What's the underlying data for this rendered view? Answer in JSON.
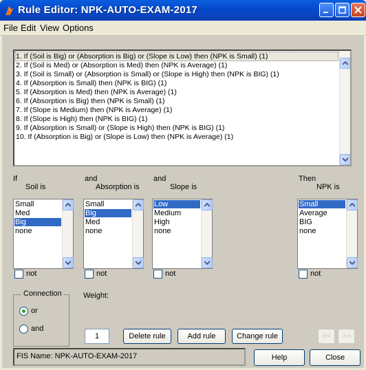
{
  "window": {
    "title": "Rule Editor: NPK-AUTO-EXAM-2017"
  },
  "menu": {
    "items": [
      "File",
      "Edit",
      "View",
      "Options"
    ]
  },
  "rules": [
    "1. If (Soil is Big) or (Absorption is Big) or (Slope is Low) then (NPK is Small) (1)",
    "2. If (Soil is Med) or (Absorption is Med) then (NPK is Average) (1)",
    "3. If (Soil is Small) or (Absorption is Small) or (Slope is High) then (NPK is BIG) (1)",
    "4. If (Absorption is Small) then (NPK is BIG) (1)",
    "5. If (Absorption is Med) then (NPK is Average) (1)",
    "6. If (Absorption is Big) then (NPK is Small) (1)",
    "7. If (Slope is Medium) then (NPK is Average) (1)",
    "8. If (Slope is High) then (NPK is BIG) (1)",
    "9. If (Absorption is Small) or (Slope is High) then (NPK is BIG) (1)",
    "10. If (Absorption is Big) or (Slope is Low) then (NPK is Average) (1)"
  ],
  "selected_rule": 0,
  "inputs": [
    {
      "prefix": "If",
      "name": "Soil is",
      "options": [
        "Small",
        "Med",
        "Big",
        "none"
      ],
      "selected": 2,
      "not_label": "not"
    },
    {
      "prefix": "and",
      "name": "Absorption is",
      "options": [
        "Small",
        "Big",
        "Med",
        "none"
      ],
      "selected": 1,
      "not_label": "not"
    },
    {
      "prefix": "and",
      "name": "Slope is",
      "options": [
        "Low",
        "Medium",
        "High",
        "none"
      ],
      "selected": 0,
      "not_label": "not"
    }
  ],
  "output": {
    "prefix": "Then",
    "name": "NPK is",
    "options": [
      "Small",
      "Average",
      "BIG",
      "none"
    ],
    "selected": 0,
    "not_label": "not"
  },
  "connection": {
    "title": "Connection",
    "options": [
      "or",
      "and"
    ],
    "selected": "or"
  },
  "weight": {
    "label": "Weight:",
    "value": "1"
  },
  "buttons": {
    "delete": "Delete rule",
    "add": "Add rule",
    "change": "Change rule",
    "prev": "<<",
    "next": ">>",
    "help": "Help",
    "close": "Close"
  },
  "status": "FIS Name: NPK-AUTO-EXAM-2017"
}
